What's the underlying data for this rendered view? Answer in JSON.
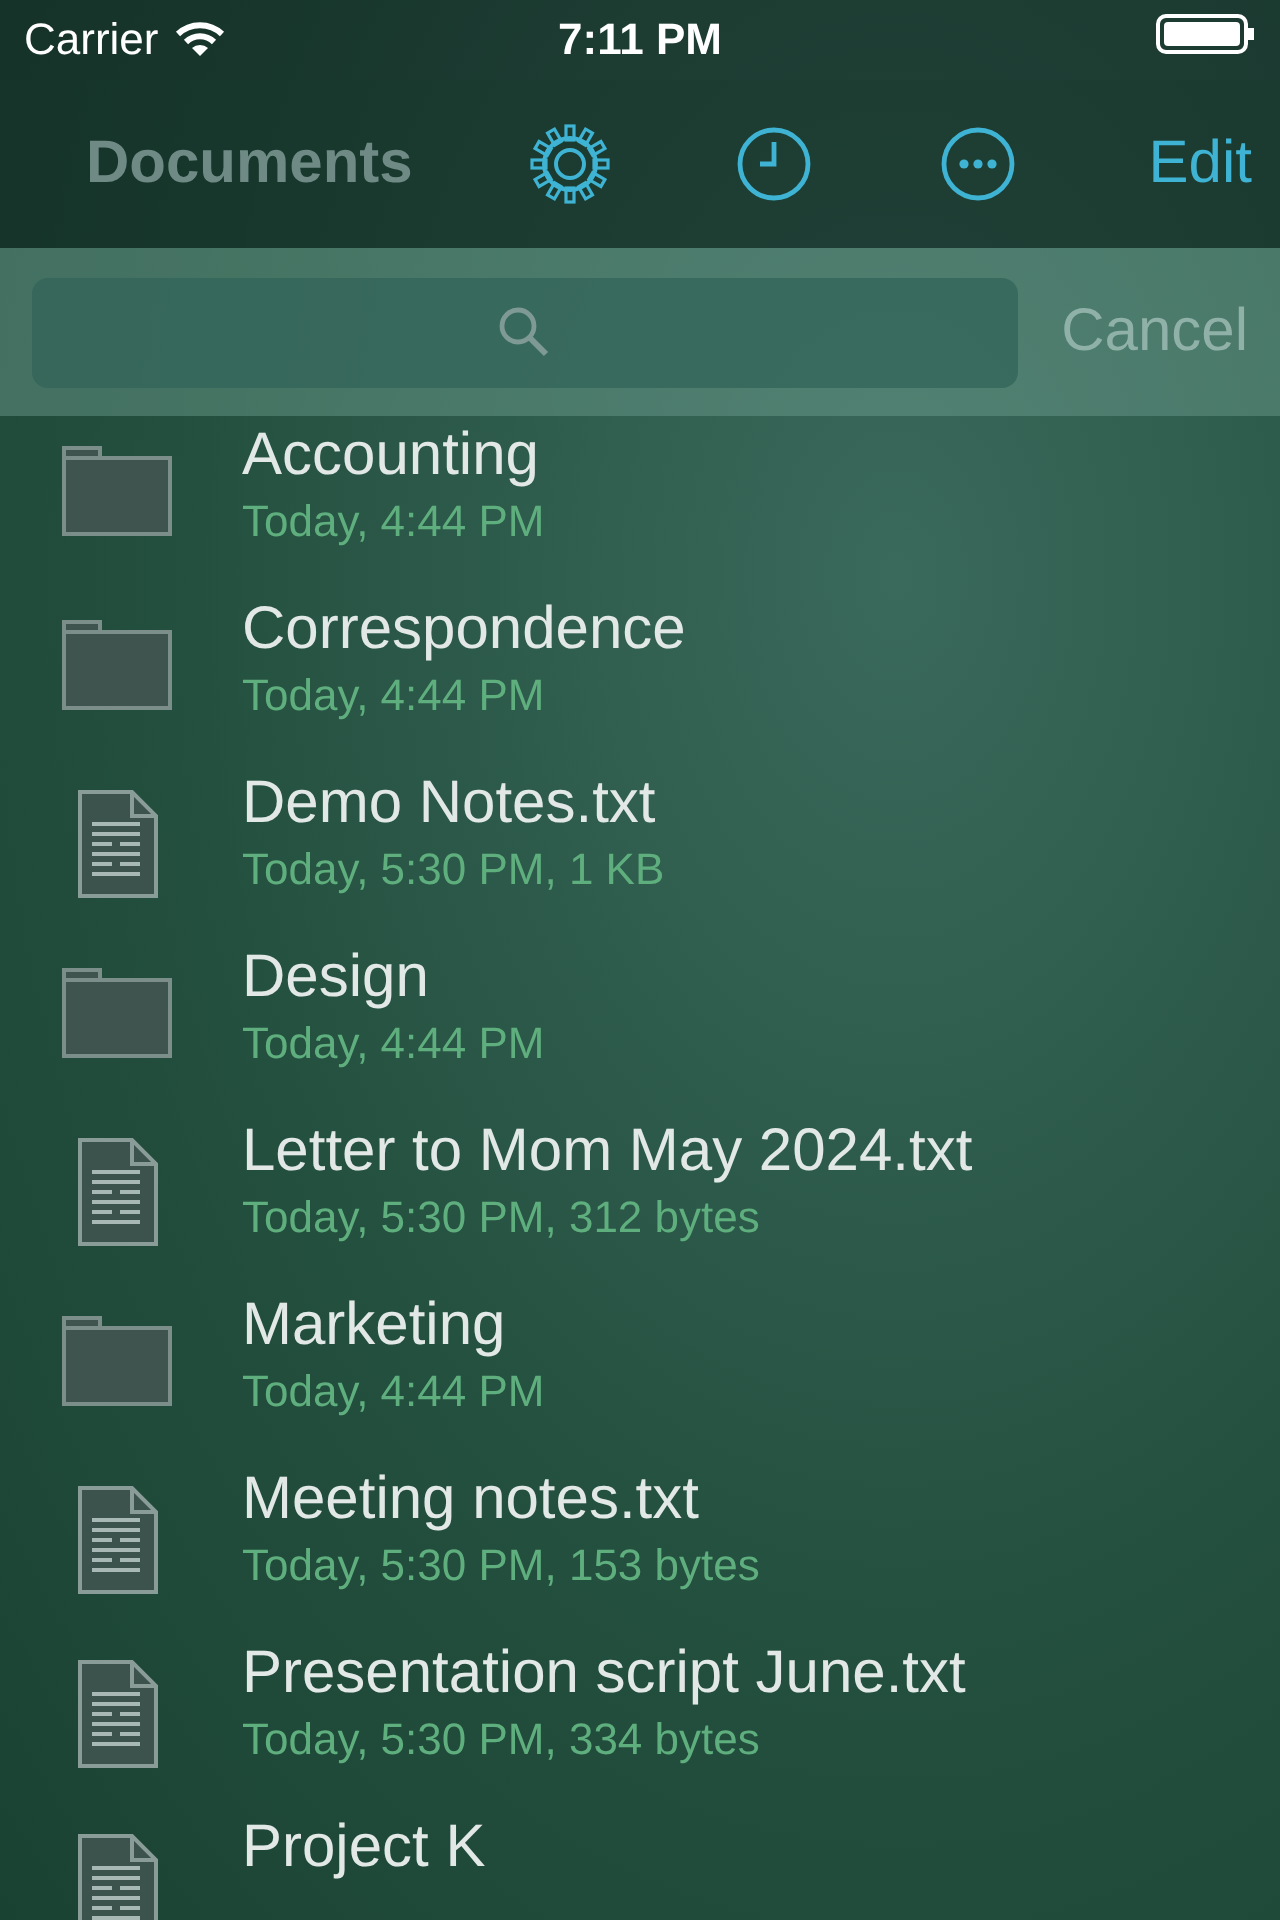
{
  "status_bar": {
    "carrier": "Carrier",
    "time": "7:11 PM"
  },
  "nav_bar": {
    "title": "Documents",
    "edit": "Edit"
  },
  "search": {
    "cancel": "Cancel"
  },
  "items": [
    {
      "kind": "folder",
      "name": "Accounting",
      "details": "Today, 4:44 PM"
    },
    {
      "kind": "folder",
      "name": "Correspondence",
      "details": "Today, 4:44 PM"
    },
    {
      "kind": "file",
      "name": "Demo Notes.txt",
      "details": "Today, 5:30 PM, 1 KB"
    },
    {
      "kind": "folder",
      "name": "Design",
      "details": "Today, 4:44 PM"
    },
    {
      "kind": "file",
      "name": "Letter to Mom May 2024.txt",
      "details": "Today, 5:30 PM, 312 bytes"
    },
    {
      "kind": "folder",
      "name": "Marketing",
      "details": "Today, 4:44 PM"
    },
    {
      "kind": "file",
      "name": "Meeting notes.txt",
      "details": "Today, 5:30 PM, 153 bytes"
    },
    {
      "kind": "file",
      "name": "Presentation script June.txt",
      "details": "Today, 5:30 PM, 334 bytes"
    },
    {
      "kind": "file",
      "name": "Project K"
    }
  ]
}
